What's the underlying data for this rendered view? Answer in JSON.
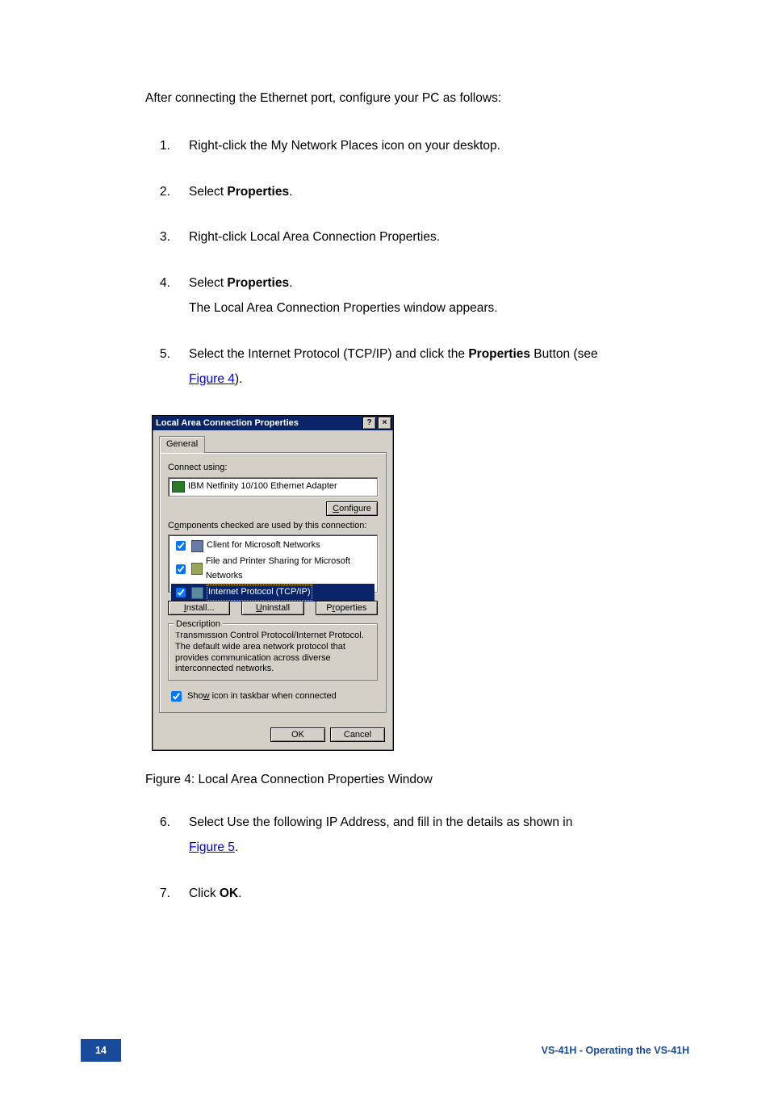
{
  "intro": "After connecting the Ethernet port, configure your PC as follows:",
  "steps": [
    {
      "n": "1.",
      "lines": [
        {
          "parts": [
            {
              "t": "Right-click the My Network Places icon on your desktop."
            }
          ]
        }
      ]
    },
    {
      "n": "2.",
      "lines": [
        {
          "parts": [
            {
              "t": "Select "
            },
            {
              "t": "Properties",
              "b": true
            },
            {
              "t": "."
            }
          ]
        }
      ]
    },
    {
      "n": "3.",
      "lines": [
        {
          "parts": [
            {
              "t": "Right-click Local Area Connection Properties."
            }
          ]
        }
      ]
    },
    {
      "n": "4.",
      "lines": [
        {
          "parts": [
            {
              "t": "Select "
            },
            {
              "t": "Properties",
              "b": true
            },
            {
              "t": "."
            }
          ]
        },
        {
          "parts": [
            {
              "t": "The Local Area Connection Properties window appears."
            }
          ]
        }
      ]
    },
    {
      "n": "5.",
      "lines": [
        {
          "parts": [
            {
              "t": "Select the Internet Protocol (TCP/IP) and click the "
            },
            {
              "t": "Properties",
              "b": true
            },
            {
              "t": " Button (see"
            }
          ]
        },
        {
          "parts": [
            {
              "t": "Figure 4",
              "link": true
            },
            {
              "t": ")."
            }
          ]
        }
      ]
    }
  ],
  "dialog": {
    "title": "Local Area Connection Properties",
    "help_btn": "?",
    "close_btn": "×",
    "tab_label": "General",
    "connect_using_label": "Connect using:",
    "adapter_name": "IBM Netfinity 10/100 Ethernet Adapter",
    "configure_btn": "Configure",
    "components_label": "Components checked are used by this connection:",
    "components": [
      {
        "checked": true,
        "label": "Client for Microsoft Networks",
        "icon": "client",
        "selected": false
      },
      {
        "checked": true,
        "label": "File and Printer Sharing for Microsoft Networks",
        "icon": "printer",
        "selected": false
      },
      {
        "checked": true,
        "label": "Internet Protocol (TCP/IP)",
        "icon": "tcp",
        "selected": true
      }
    ],
    "install_btn": "Install...",
    "uninstall_btn": "Uninstall",
    "properties_btn": "Properties",
    "description_title": "Description",
    "description_text": "Transmission Control Protocol/Internet Protocol. The default wide area network protocol that provides communication across diverse interconnected networks.",
    "show_icon_checked": true,
    "show_icon_label": "Show icon in taskbar when connected",
    "ok_btn": "OK",
    "cancel_btn": "Cancel"
  },
  "figure_caption": "Figure 4: Local Area Connection Properties Window",
  "steps2": [
    {
      "n": "6.",
      "lines": [
        {
          "parts": [
            {
              "t": "Select Use the following IP Address, and fill in the details as shown in"
            }
          ]
        },
        {
          "parts": [
            {
              "t": "Figure 5",
              "link": true
            },
            {
              "t": "."
            }
          ]
        }
      ]
    },
    {
      "n": "7.",
      "lines": [
        {
          "parts": [
            {
              "t": "Click "
            },
            {
              "t": "OK",
              "b": true
            },
            {
              "t": "."
            }
          ]
        }
      ]
    }
  ],
  "footer": {
    "page_num": "14",
    "right": "VS-41H - Operating the VS-41H"
  }
}
